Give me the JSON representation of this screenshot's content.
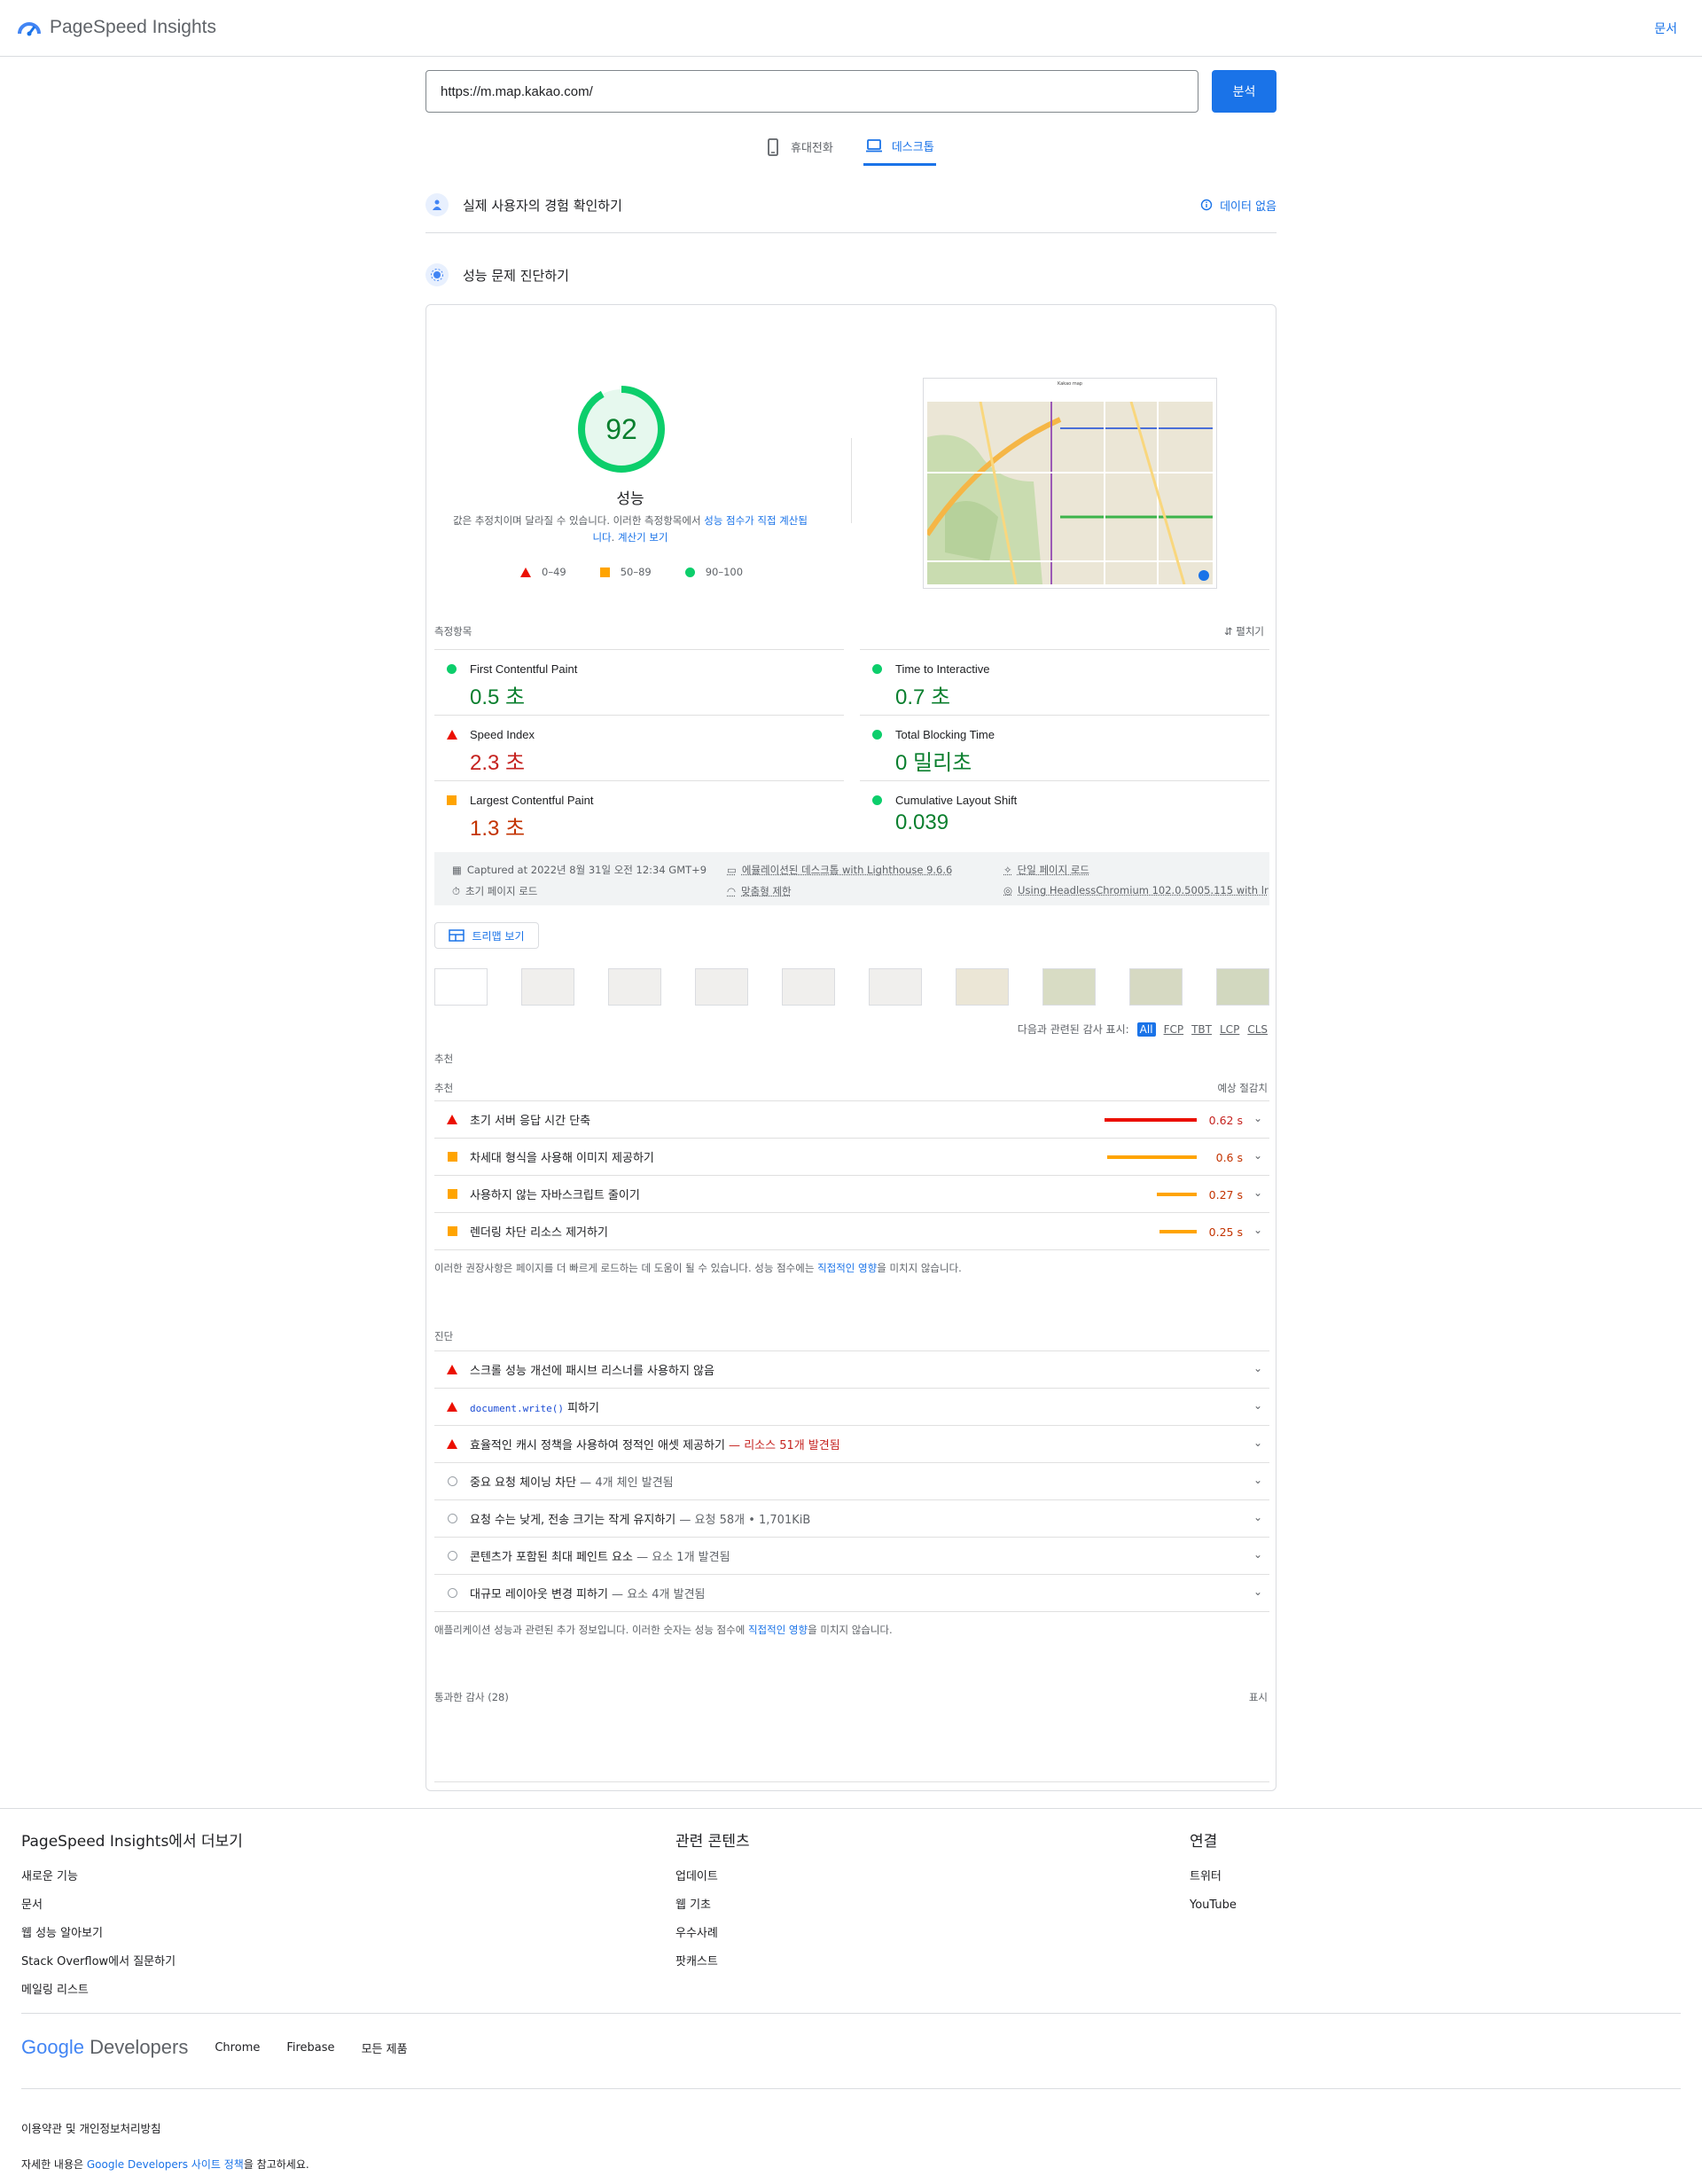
{
  "header": {
    "brand": "PageSpeed Insights",
    "docs_link": "문서"
  },
  "search": {
    "url_value": "https://m.map.kakao.com/",
    "analyze_label": "분석"
  },
  "device_tabs": [
    {
      "label": "휴대전화",
      "active": false
    },
    {
      "label": "데스크톱",
      "active": true
    }
  ],
  "field_section": {
    "title": "실제 사용자의 경험 확인하기",
    "no_data": "데이터 없음"
  },
  "lab_section": {
    "title": "성능 문제 진단하기"
  },
  "score": {
    "value": "92",
    "fraction": 0.92,
    "label": "성능",
    "note_prefix": "값은 추정치이며 달라질 수 있습니다. 이러한 측정항목에서 ",
    "note_link": "성능 점수가 직접 계산됩니다",
    "note_suffix": ". ",
    "calc_link": "계산기 보기",
    "legend": [
      "0–49",
      "50–89",
      "90–100"
    ]
  },
  "screenshot": {
    "title": "Kakao map"
  },
  "metrics_header": {
    "label": "측정항목",
    "expand": "펼치기"
  },
  "metrics": [
    {
      "name": "First Contentful Paint",
      "value": "0.5 초",
      "status": "pass"
    },
    {
      "name": "Time to Interactive",
      "value": "0.7 초",
      "status": "pass"
    },
    {
      "name": "Speed Index",
      "value": "2.3 초",
      "status": "fail"
    },
    {
      "name": "Total Blocking Time",
      "value": "0 밀리초",
      "status": "pass"
    },
    {
      "name": "Largest Contentful Paint",
      "value": "1.3 초",
      "status": "average"
    },
    {
      "name": "Cumulative Layout Shift",
      "value": "0.039",
      "status": "pass"
    }
  ],
  "environment": {
    "captured": "Captured at 2022년 8월 31일 오전 12:34 GMT+9",
    "initial_load": "초기 페이지 로드",
    "emulated": "에뮬레이션된 데스크톱 with Lighthouse 9.6.6",
    "throttling": "맞춤형 제한",
    "single_page": "단일 페이지 로드",
    "browser": "Using HeadlessChromium 102.0.5005.115 with lr"
  },
  "treemap_label": "트리맵 보기",
  "filter": {
    "label": "다음과 관련된 감사 표시:",
    "chips": [
      "All",
      "FCP",
      "TBT",
      "LCP",
      "CLS"
    ]
  },
  "opportunities": {
    "group_label": "추천",
    "col_left": "추천",
    "col_right": "예상 절감치",
    "items": [
      {
        "title": "초기 서버 응답 시간 단축",
        "savings": "0.62 s",
        "status": "fail",
        "savings_sec": 0.62
      },
      {
        "title": "차세대 형식을 사용해 이미지 제공하기",
        "savings": "0.6 s",
        "status": "average",
        "savings_sec": 0.6
      },
      {
        "title": "사용하지 않는 자바스크립트 줄이기",
        "savings": "0.27 s",
        "status": "average",
        "savings_sec": 0.27
      },
      {
        "title": "렌더링 차단 리소스 제거하기",
        "savings": "0.25 s",
        "status": "average",
        "savings_sec": 0.25
      }
    ],
    "note_prefix": "이러한 권장사항은 페이지를 더 빠르게 로드하는 데 도움이 될 수 있습니다. 성능 점수에는 ",
    "note_link": "직접적인 영향",
    "note_suffix": "을 미치지 않습니다."
  },
  "diagnostics": {
    "label": "진단",
    "items": [
      {
        "title": "스크롤 성능 개선에 패시브 리스너를 사용하지 않음",
        "extra": "",
        "status": "fail"
      },
      {
        "code": "document.write()",
        "title": " 피하기",
        "extra": "",
        "status": "fail"
      },
      {
        "title": "효율적인 캐시 정책을 사용하여 정적인 애셋 제공하기",
        "extra": "리소스 51개 발견됨",
        "status": "fail"
      },
      {
        "title": "중요 요청 체이닝 차단",
        "extra": "4개 체인 발견됨",
        "status": "info"
      },
      {
        "title": "요청 수는 낮게, 전송 크기는 작게 유지하기",
        "extra": "요청 58개 • 1,701KiB",
        "status": "info"
      },
      {
        "title": "콘텐츠가 포함된 최대 페인트 요소",
        "extra": "요소 1개 발견됨",
        "status": "info"
      },
      {
        "title": "대규모 레이아웃 변경 피하기",
        "extra": "요소 4개 발견됨",
        "status": "info"
      }
    ],
    "note_prefix": "애플리케이션 성능과 관련된 추가 정보입니다. 이러한 숫자는 성능 점수에 ",
    "note_link": "직접적인 영향",
    "note_suffix": "을 미치지 않습니다."
  },
  "passed": {
    "label": "통과한 감사 (28)",
    "show": "표시"
  },
  "footer": {
    "col1": {
      "title": "PageSpeed Insights에서 더보기",
      "links": [
        "새로운 기능",
        "문서",
        "웹 성능 알아보기",
        "Stack Overflow에서 질문하기",
        "메일링 리스트"
      ]
    },
    "col2": {
      "title": "관련 콘텐츠",
      "links": [
        "업데이트",
        "웹 기초",
        "우수사례",
        "팟캐스트"
      ]
    },
    "col3": {
      "title": "연결",
      "links": [
        "트위터",
        "YouTube"
      ]
    },
    "brand_google": "Google",
    "brand_dev": "Developers",
    "products": [
      "Chrome",
      "Firebase",
      "모든 제품"
    ],
    "terms": "이용약관 및 개인정보처리방침",
    "details_prefix": "자세한 내용은 ",
    "details_link": "Google Developers 사이트 정책",
    "details_suffix": "을 참고하세요."
  },
  "colors": {
    "accent": "#1a73e8",
    "pass": "#0cce6b",
    "average": "#ffa400",
    "fail": "#eb0f00"
  }
}
